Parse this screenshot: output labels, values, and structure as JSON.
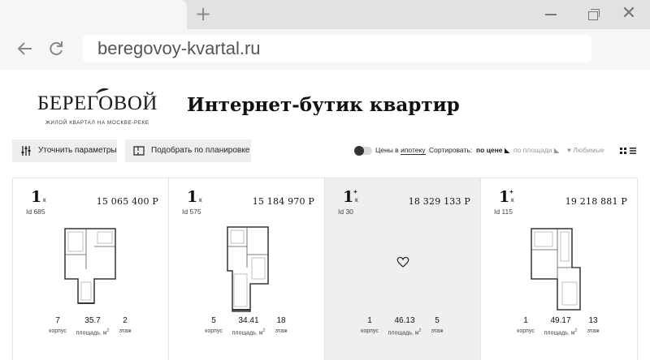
{
  "browser": {
    "url": "beregovoy-kvartal.ru",
    "new_tab_symbol": "+",
    "close_symbol": "✕"
  },
  "logo": {
    "name": "БЕРЕГОВОЙ",
    "tagline": "ЖИЛОЙ КВАРТАЛ НА МОСКВЕ-РЕКЕ"
  },
  "page_title": "Интернет-бутик квартир",
  "filters": {
    "params_label": "Уточнить параметры",
    "plan_label": "Подобрать по планировке"
  },
  "controls": {
    "prices_prefix": "Цены в",
    "prices_link": "ипотеку",
    "sort_label": "Сортировать:",
    "sort_price": "по цене",
    "sort_area": "по площади",
    "favorites": "Любимые"
  },
  "stat_labels": {
    "building": "корпус",
    "area": "площадь, м",
    "floor": "этаж"
  },
  "apartments": [
    {
      "rooms": "1",
      "unit": "к",
      "plus": "",
      "id": "Id 685",
      "price": "15 065 400 Р",
      "building": "7",
      "area": "35.7",
      "floor": "2"
    },
    {
      "rooms": "1",
      "unit": "к",
      "plus": "",
      "id": "Id 575",
      "price": "15 184 970 Р",
      "building": "5",
      "area": "34.41",
      "floor": "18"
    },
    {
      "rooms": "1",
      "unit": "к",
      "plus": "+",
      "id": "Id 30",
      "price": "18 329 133 Р",
      "building": "1",
      "area": "46.13",
      "floor": "5"
    },
    {
      "rooms": "1",
      "unit": "к",
      "plus": "+",
      "id": "Id 115",
      "price": "19 218 881 Р",
      "building": "1",
      "area": "49.17",
      "floor": "13"
    }
  ],
  "colors": {
    "hover_card": "#efefef",
    "button_bg": "#eeeeee",
    "chrome_bg": "#e2e2e2"
  }
}
